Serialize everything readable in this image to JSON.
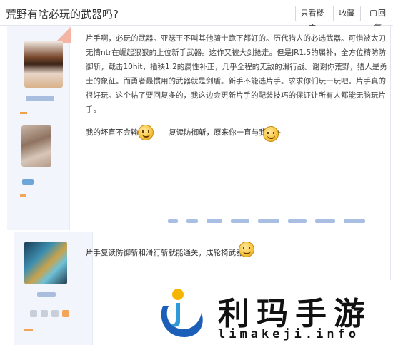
{
  "header": {
    "title": "荒野有啥必玩的武器吗?",
    "buttons": [
      "只看楼主",
      "收藏",
      "回复"
    ]
  },
  "post1": {
    "paragraph": "片手啊，必玩的武器。亚瑟王不叫其他骑士跪下都好的。历代猎人的必选武器。可惜被太刀无情ntr在崛起狠狠的上位新手武器。这作又被大剑抢走。但是JR1.5的属补，全方位精防防御斩，载击10hit，插秧1.2的属性补正，几乎全程的无敌的滑行战。谢谢你荒野，猎人是勇士的象征。而勇者最惯用的武器就是剑盾。新手不能选片手。求求你们玩一玩吧。片手真的很好玩。这个帖了要回复多的，我这边会更新片手的配装技巧的保证让所有人都能无脑玩片手。",
    "line2_a": "我的坏直不会输",
    "line2_b": "复读防御斩，原来你一直与我同在"
  },
  "post2": {
    "text": "片手复读防御斩和滑行斩就能通关，成轮椅武器了"
  },
  "watermark": {
    "title": "利玛手游",
    "subtitle": "limakeji.info"
  },
  "icons": {
    "emoji": "smiley-face-icon",
    "logo": "limakeji-logo-icon"
  },
  "colors": {
    "sidebar_bg": "#f2f5fb",
    "link_blur": "#a8bfe3",
    "accent_orange": "#f2a65a"
  }
}
